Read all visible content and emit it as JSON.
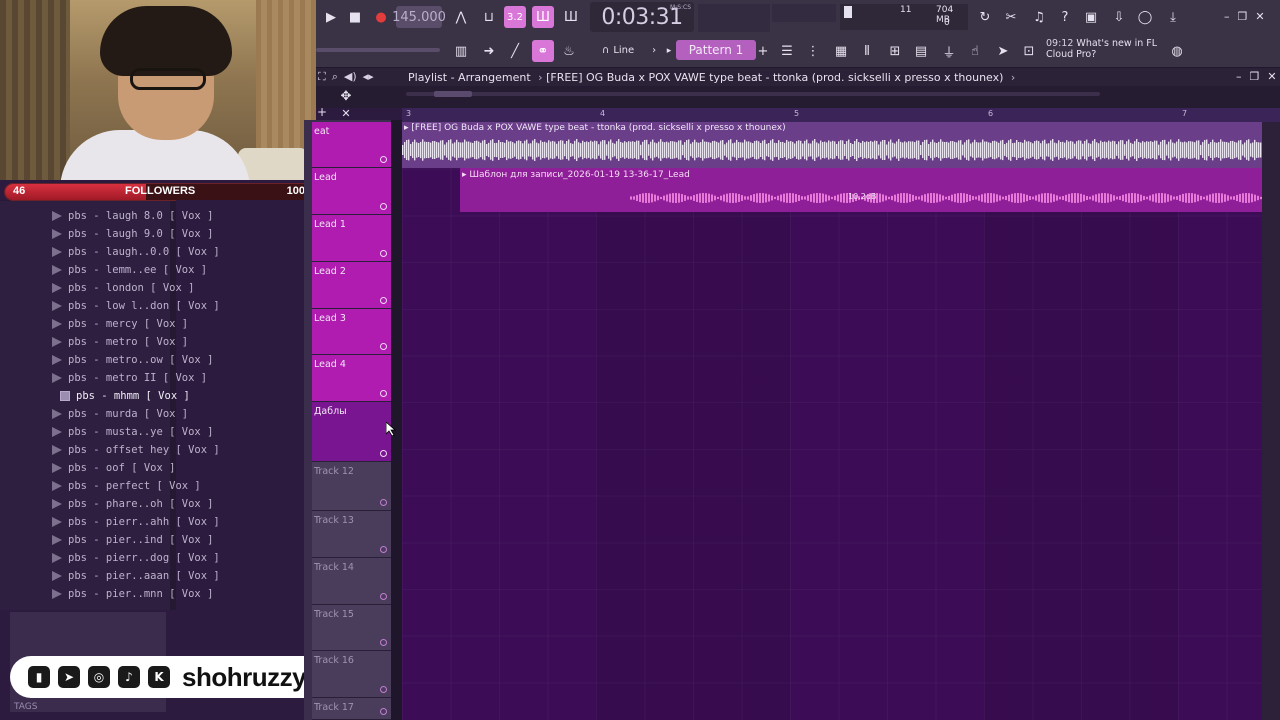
{
  "overlay": {
    "followers_label": "FOLLOWERS",
    "followers_current": "46",
    "followers_goal": "100",
    "followers_progress": 0.46,
    "social_handle": "shohruzzy",
    "social_icons": [
      "twitch-icon",
      "telegram-icon",
      "instagram-icon",
      "tiktok-icon",
      "kick-icon"
    ],
    "kick_letter": "K",
    "tags_label": "TAGS"
  },
  "browser": {
    "items": [
      {
        "label": "pbs - laugh 8.0 [ Vox ]"
      },
      {
        "label": "pbs - laugh 9.0 [ Vox ]"
      },
      {
        "label": "pbs - laugh..0.0 [ Vox ]"
      },
      {
        "label": "pbs - lemm..ee [ Vox ]"
      },
      {
        "label": "pbs - london [ Vox ]"
      },
      {
        "label": "pbs - low l..don [ Vox ]"
      },
      {
        "label": "pbs - mercy [ Vox ]"
      },
      {
        "label": "pbs - metro [ Vox ]"
      },
      {
        "label": "pbs - metro..ow [ Vox ]"
      },
      {
        "label": "pbs - metro II [ Vox ]"
      },
      {
        "label": "pbs - mhmm [ Vox ]",
        "selected": true
      },
      {
        "label": "pbs - murda [ Vox ]"
      },
      {
        "label": "pbs - musta..ye [ Vox ]"
      },
      {
        "label": "pbs - offset hey [ Vox ]"
      },
      {
        "label": "pbs - oof [ Vox ]"
      },
      {
        "label": "pbs - perfect [ Vox ]"
      },
      {
        "label": "pbs - phare..oh [ Vox ]"
      },
      {
        "label": "pbs - pierr..ahh [ Vox ]"
      },
      {
        "label": "pbs - pier..ind [ Vox ]"
      },
      {
        "label": "pbs - pierr..dog [ Vox ]"
      },
      {
        "label": "pbs - pier..aaan [ Vox ]"
      },
      {
        "label": "pbs - pier..mnn [ Vox ]"
      }
    ]
  },
  "toolbar": {
    "tempo": "145.000",
    "time": "0:03:31",
    "time_unit": "M:S:CS",
    "cpu_voices": "11",
    "memory": "704 MB",
    "cpu_zero": "0",
    "pattern": "Pattern 1",
    "snap": "Line",
    "news_time": "09:12",
    "news_text": "What's new in FL Cloud Pro?",
    "step_label": "3.2"
  },
  "playlist": {
    "title": "Playlist - Arrangement",
    "arrangement_name": "[FREE] OG Buda x POX VAWE type beat - ttonka (prod. sickselli x presso x thounex)",
    "ruler": [
      "3",
      "4",
      "5",
      "6",
      "7"
    ],
    "tracks": [
      {
        "name": "eat",
        "color": "pink"
      },
      {
        "name": "Lead",
        "color": "pink"
      },
      {
        "name": "Lead 1",
        "color": "pink"
      },
      {
        "name": "Lead 2",
        "color": "pink"
      },
      {
        "name": "Lead 3",
        "color": "pink"
      },
      {
        "name": "Lead 4",
        "color": "pink"
      },
      {
        "name": "Даблы",
        "color": "purple"
      },
      {
        "name": "Track 12",
        "color": "grey"
      },
      {
        "name": "Track 13",
        "color": "grey"
      },
      {
        "name": "Track 14",
        "color": "grey"
      },
      {
        "name": "Track 15",
        "color": "grey"
      },
      {
        "name": "Track 16",
        "color": "grey"
      },
      {
        "name": "Track 17",
        "color": "grey"
      }
    ],
    "clip1_label": "[FREE] OG Buda x POX VAWE type beat - ttonka (prod. sickselli x presso x thounex)",
    "clip2_label": "Шаблон для записи_2026-01-19 13-36-17_Lead",
    "clip2_gain": "10.2dB"
  },
  "colors": {
    "accent": "#d977d8",
    "track_pink": "#b01cb0",
    "track_purple": "#7a1591",
    "grid_bg": "#3c0d56",
    "followers_red": "#d83040"
  }
}
